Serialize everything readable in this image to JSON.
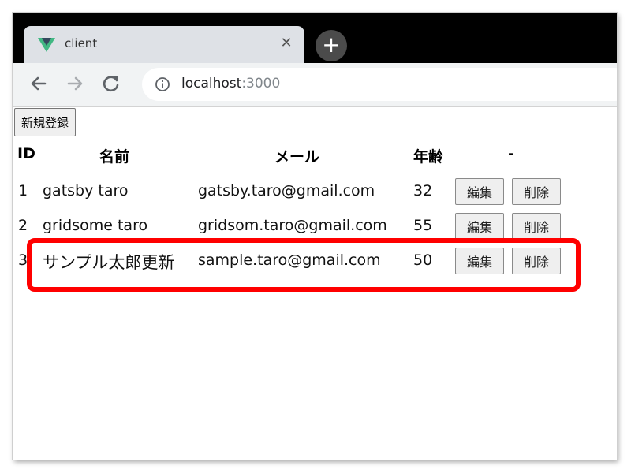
{
  "browser": {
    "tab_title": "client",
    "close_glyph": "✕",
    "newtab_glyph": "+",
    "url_host": "localhost",
    "url_port": ":3000"
  },
  "page": {
    "register_label": "新規登録",
    "columns": {
      "id": "ID",
      "name": "名前",
      "email": "メール",
      "age": "年齢",
      "actions": "-"
    },
    "rows": [
      {
        "id": "1",
        "name": "gatsby taro",
        "email": "gatsby.taro@gmail.com",
        "age": "32",
        "edit": "編集",
        "delete": "削除"
      },
      {
        "id": "2",
        "name": "gridsome taro",
        "email": "gridsom.taro@gmail.com",
        "age": "55",
        "edit": "編集",
        "delete": "削除"
      },
      {
        "id": "3",
        "name": "サンプル太郎更新",
        "email": "sample.taro@gmail.com",
        "age": "50",
        "edit": "編集",
        "delete": "削除"
      }
    ]
  },
  "colors": {
    "highlight": "#ff0000",
    "tabstrip": "#000000",
    "toolbar": "#f1f3f4"
  },
  "icons": [
    "vue-logo-icon",
    "close-icon",
    "plus-icon",
    "back-arrow-icon",
    "forward-arrow-icon",
    "reload-icon",
    "info-icon"
  ]
}
